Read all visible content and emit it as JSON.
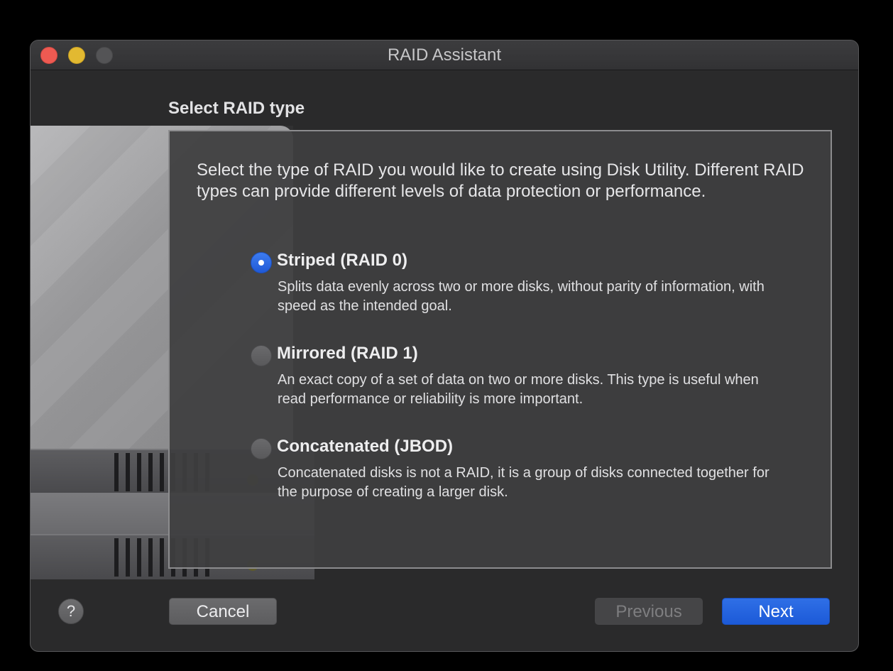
{
  "window": {
    "title": "RAID Assistant"
  },
  "page": {
    "heading": "Select RAID type",
    "intro": "Select the type of RAID you would like to create using Disk Utility. Different RAID types can provide different levels of data protection or performance."
  },
  "options": [
    {
      "label": "Striped (RAID 0)",
      "description": "Splits data evenly across two or more disks, without parity of information, with speed as the intended goal.",
      "selected": true
    },
    {
      "label": "Mirrored (RAID 1)",
      "description": "An exact copy of a set of data on two or more disks. This type is useful when read performance or reliability is more important.",
      "selected": false
    },
    {
      "label": "Concatenated (JBOD)",
      "description": "Concatenated disks is not a RAID, it is a group of disks connected together for the purpose of creating a larger disk.",
      "selected": false
    }
  ],
  "footer": {
    "help_label": "?",
    "cancel_label": "Cancel",
    "previous_label": "Previous",
    "previous_enabled": false,
    "next_label": "Next"
  },
  "colors": {
    "accent": "#1f5fdc",
    "window_bg": "#2a2a2b",
    "close": "#ee5a52",
    "minimize": "#e2b931",
    "zoom_disabled": "#545456"
  },
  "icons": {
    "help": "question-mark-icon",
    "illustration": "disk-enclosure-illustration"
  }
}
